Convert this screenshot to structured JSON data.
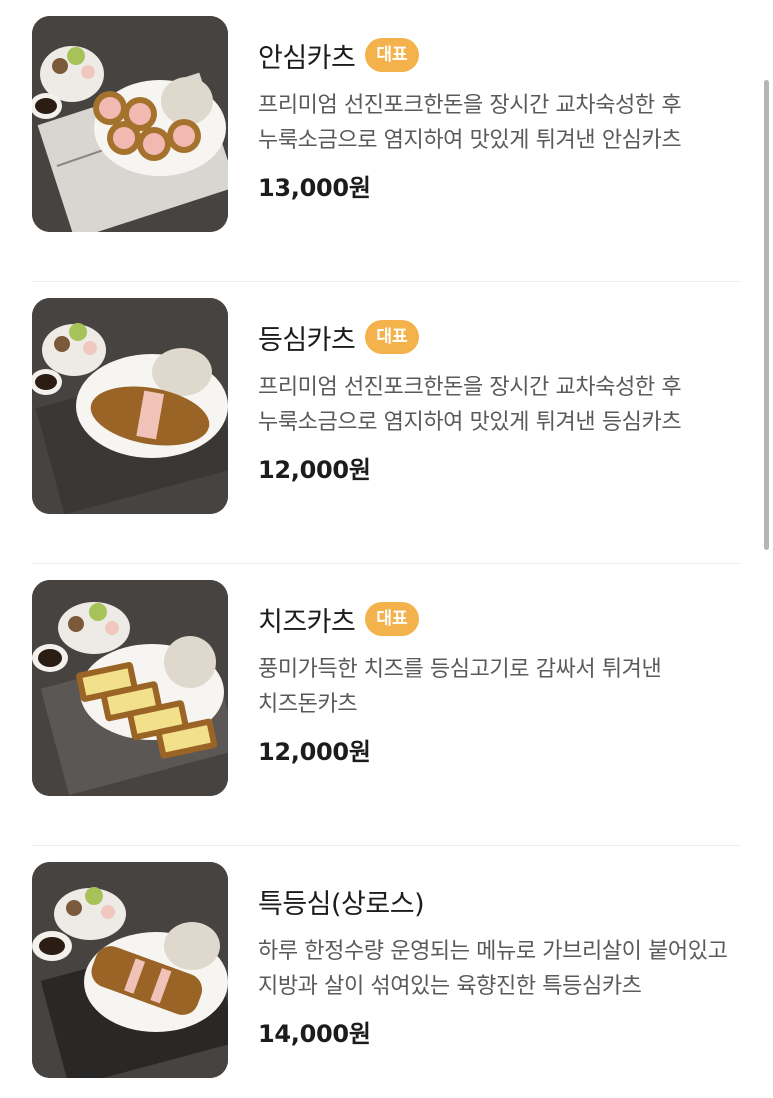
{
  "menu": {
    "items": [
      {
        "name": "안심카츠",
        "badge": "대표",
        "description": "프리미엄 선진포크한돈을 장시간 교차숙성한 후 누룩소금으로 염지하여 맛있게 튀겨낸 안심카츠",
        "price": "13,000원",
        "image": "ansim-katsu-photo"
      },
      {
        "name": "등심카츠",
        "badge": "대표",
        "description": "프리미엄 선진포크한돈을 장시간 교차숙성한 후 누룩소금으로 염지하여 맛있게 튀겨낸 등심카츠",
        "price": "12,000원",
        "image": "deungsim-katsu-photo"
      },
      {
        "name": "치즈카츠",
        "badge": "대표",
        "description": "풍미가득한 치즈를 등심고기로 감싸서 튀겨낸 치즈돈카츠",
        "price": "12,000원",
        "image": "cheese-katsu-photo"
      },
      {
        "name": "특등심(상로스)",
        "badge": "",
        "description": "하루 한정수량 운영되는 메뉴로 가브리살이 붙어있고 지방과 살이 섞여있는 육향진한 특등심카츠",
        "price": "14,000원",
        "image": "special-deungsim-photo"
      }
    ]
  },
  "colors": {
    "badge_bg": "#f4b24d",
    "text_primary": "#1c1c1c",
    "text_secondary": "#5a5a5a",
    "divider": "#ededed"
  }
}
